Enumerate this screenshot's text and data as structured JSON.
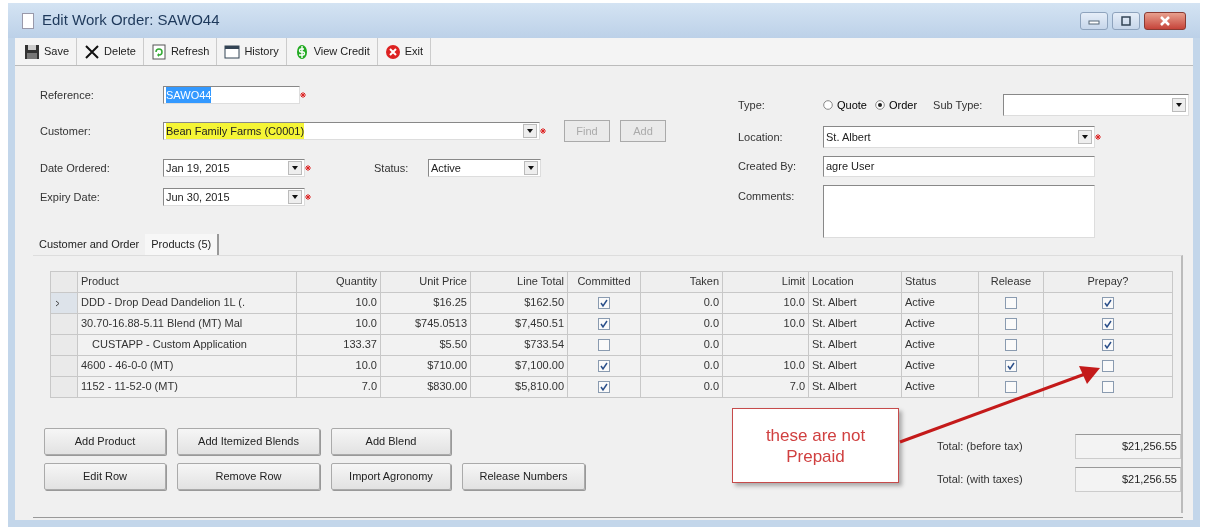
{
  "window": {
    "title": "Edit Work Order: SAWO44"
  },
  "toolbar": [
    {
      "label": "Save"
    },
    {
      "label": "Delete"
    },
    {
      "label": "Refresh"
    },
    {
      "label": "History"
    },
    {
      "label": "View Credit"
    },
    {
      "label": "Exit"
    }
  ],
  "form": {
    "reference": {
      "label": "Reference:",
      "value": "SAWO44",
      "selected": true,
      "required": true
    },
    "customer": {
      "label": "Customer:",
      "value": "Bean Family Farms (C0001)",
      "highlighted": true,
      "required": true,
      "buttons": [
        {
          "label": "Find",
          "disabled": true
        },
        {
          "label": "Add",
          "disabled": true
        }
      ]
    },
    "date_ordered": {
      "label": "Date Ordered:",
      "value": "Jan  19, 2015",
      "required": true
    },
    "status": {
      "label": "Status:",
      "value": "Active"
    },
    "expiry_date": {
      "label": "Expiry Date:",
      "value": "Jun 30, 2015",
      "required": true
    },
    "type": {
      "label": "Type:",
      "options": [
        {
          "label": "Quote",
          "selected": false
        },
        {
          "label": "Order",
          "selected": true
        }
      ]
    },
    "sub_type": {
      "label": "Sub Type:"
    },
    "location": {
      "label": "Location:",
      "value": "St. Albert",
      "required": true
    },
    "created_by": {
      "label": "Created By:",
      "value": "agre User"
    },
    "comments": {
      "label": "Comments:"
    }
  },
  "tabs": [
    {
      "label": "Customer and Order",
      "selected": false
    },
    {
      "label": "Products (5)",
      "selected": true
    }
  ],
  "grid": {
    "columns": [
      {
        "label": "Product"
      },
      {
        "label": "Quantity"
      },
      {
        "label": "Unit Price"
      },
      {
        "label": "Line Total"
      },
      {
        "label": "Committed"
      },
      {
        "label": "Taken"
      },
      {
        "label": "Limit"
      },
      {
        "label": "Location"
      },
      {
        "label": "Status"
      },
      {
        "label": "Release"
      },
      {
        "label": "Prepay?"
      }
    ],
    "rows": [
      {
        "current": true,
        "indented": false,
        "product": "DDD - Drop Dead Dandelion 1L (.",
        "quantity": "10.0",
        "unit_price": "$16.25",
        "line_total": "$162.50",
        "committed": true,
        "taken": "0.0",
        "limit": "10.0",
        "location": "St. Albert",
        "status": "Active",
        "release": false,
        "prepay": true
      },
      {
        "current": false,
        "indented": false,
        "product": "30.70-16.88-5.11 Blend (MT)  Mal",
        "quantity": "10.0",
        "unit_price": "$745.0513",
        "line_total": "$7,450.51",
        "committed": true,
        "taken": "0.0",
        "limit": "10.0",
        "location": "St. Albert",
        "status": "Active",
        "release": false,
        "prepay": true
      },
      {
        "current": false,
        "indented": true,
        "product": "CUSTAPP - Custom Application",
        "quantity": "133.37",
        "unit_price": "$5.50",
        "line_total": "$733.54",
        "committed": false,
        "taken": "0.0",
        "location": "St. Albert",
        "status": "Active",
        "release": false,
        "prepay": true
      },
      {
        "current": false,
        "indented": false,
        "product": "4600 - 46-0-0 (MT)",
        "quantity": "10.0",
        "unit_price": "$710.00",
        "line_total": "$7,100.00",
        "committed": true,
        "taken": "0.0",
        "limit": "10.0",
        "location": "St. Albert",
        "status": "Active",
        "release": true,
        "prepay": false
      },
      {
        "current": false,
        "indented": false,
        "product": "1152 - 11-52-0 (MT)",
        "quantity": "7.0",
        "unit_price": "$830.00",
        "line_total": "$5,810.00",
        "committed": true,
        "taken": "0.0",
        "limit": "7.0",
        "location": "St. Albert",
        "status": "Active",
        "release": false,
        "prepay": false
      }
    ]
  },
  "button_rows": [
    [
      "Add Product",
      "Add Itemized Blends",
      "Add Blend"
    ],
    [
      "Edit Row",
      "Remove Row",
      "Import Agronomy",
      "Release Numbers"
    ]
  ],
  "callout": {
    "text": "these are not Prepaid"
  },
  "totals": [
    {
      "label": "Total: (before tax)",
      "value": "$21,256.55"
    },
    {
      "label": "Total: (with taxes)",
      "value": "$21,256.55"
    }
  ]
}
